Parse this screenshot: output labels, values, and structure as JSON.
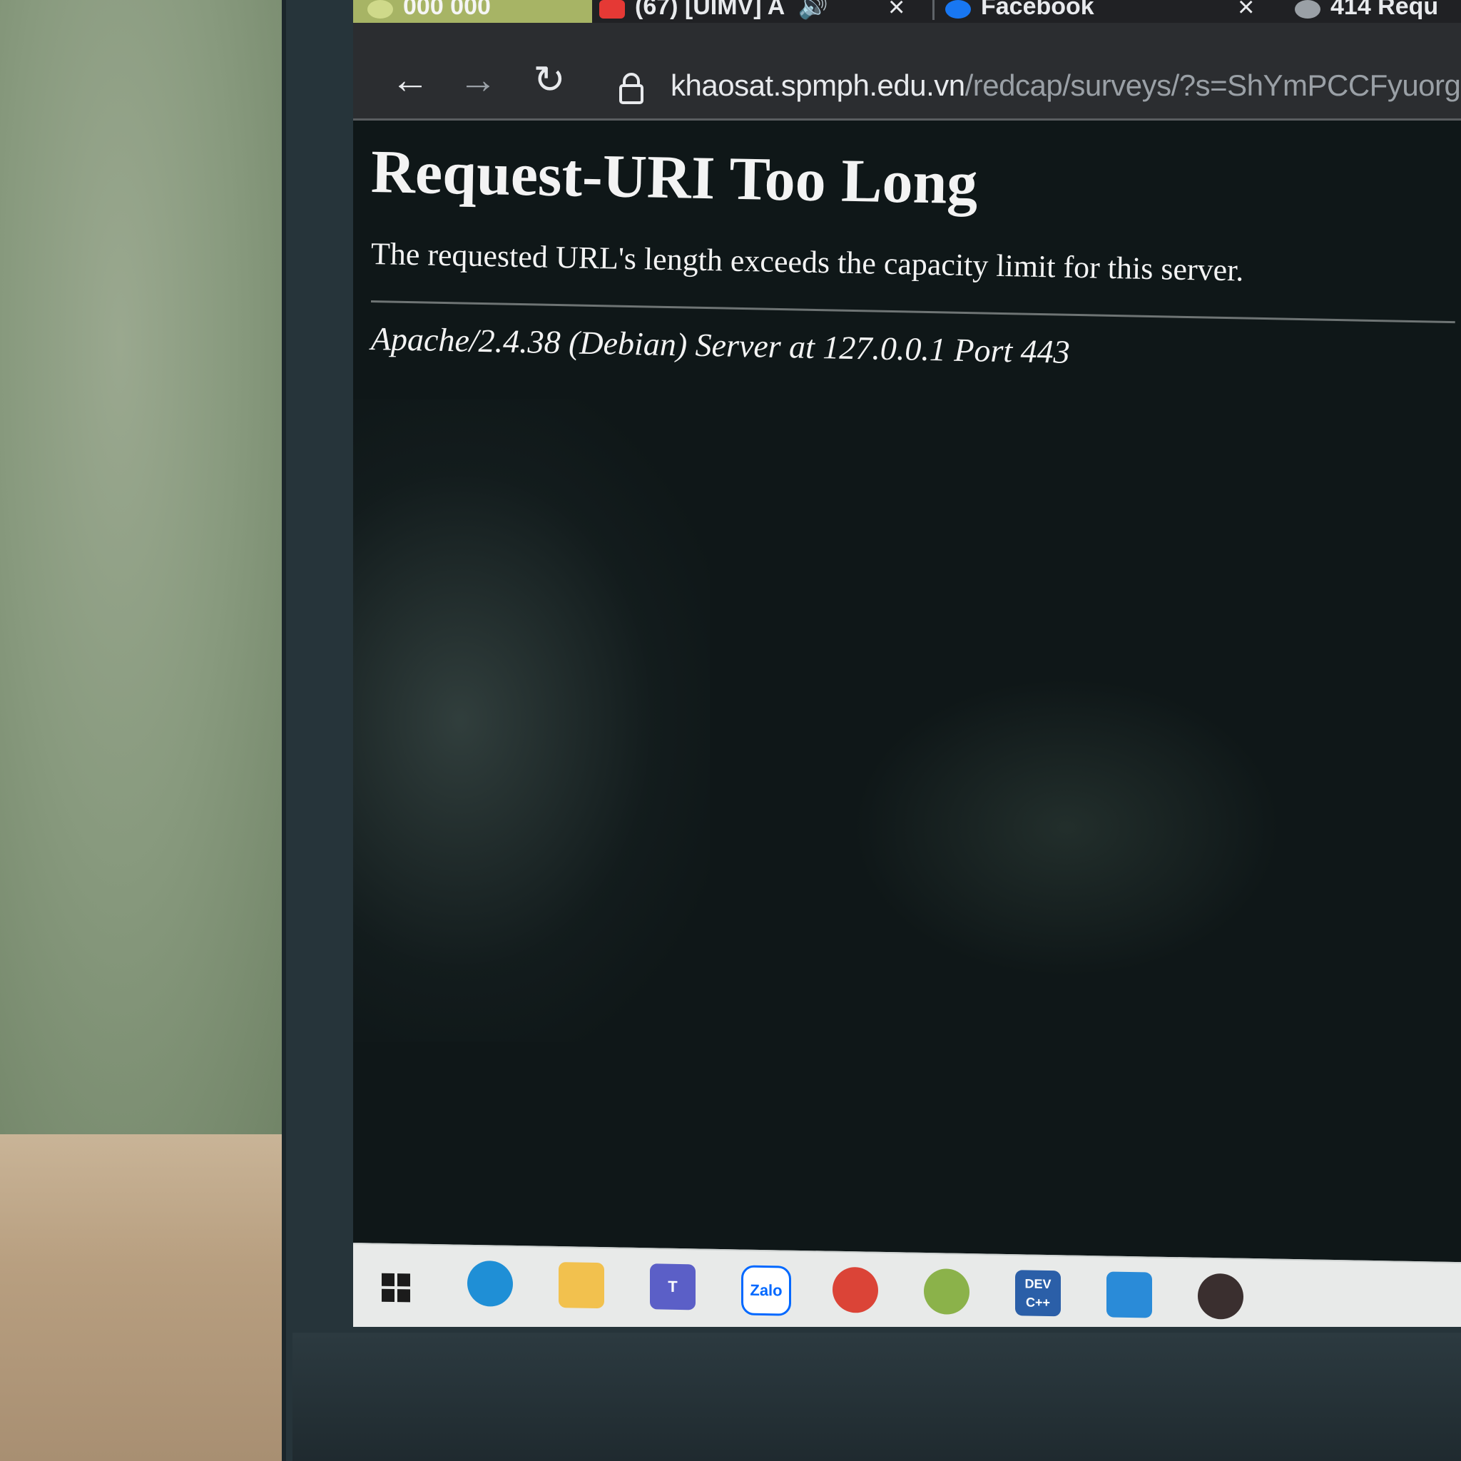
{
  "tabs": [
    {
      "label": "000 000",
      "icon": "green-tab-icon"
    },
    {
      "label": "(67) [UIMV] A",
      "icon": "youtube-icon",
      "audio": true
    },
    {
      "label": "Facebook",
      "icon": "facebook-icon"
    },
    {
      "label": "414 Requ",
      "icon": "globe-icon"
    }
  ],
  "toolbar": {
    "back_icon": "←",
    "forward_icon": "→",
    "reload_icon": "↻",
    "url_host": "khaosat.spmph.edu.vn",
    "url_path": "/redcap/surveys/?s=ShYmPCCFyuorgrCs&"
  },
  "page": {
    "title": "Request-URI Too Long",
    "message": "The requested URL's length exceeds the capacity limit for this server.",
    "server_signature": "Apache/2.4.38 (Debian) Server at 127.0.0.1 Port 443"
  },
  "taskbar": {
    "items": [
      {
        "name": "edge-icon",
        "color": "#1f8fd6",
        "label": ""
      },
      {
        "name": "file-explorer-icon",
        "color": "#f2c14e",
        "label": ""
      },
      {
        "name": "teams-icon",
        "color": "#5b5fc7",
        "label": "T"
      },
      {
        "name": "zalo-icon",
        "color": "#0068ff",
        "label": "Zalo"
      },
      {
        "name": "chrome-icon",
        "color": "#db4437",
        "label": ""
      },
      {
        "name": "chrome-profile-icon",
        "color": "#8bb24a",
        "label": ""
      },
      {
        "name": "dev-cpp-icon",
        "color": "#2b5fa8",
        "label": "DEV C++"
      },
      {
        "name": "photos-icon",
        "color": "#2a8bd8",
        "label": ""
      },
      {
        "name": "media-player-icon",
        "color": "#3a2f2f",
        "label": ""
      }
    ]
  }
}
